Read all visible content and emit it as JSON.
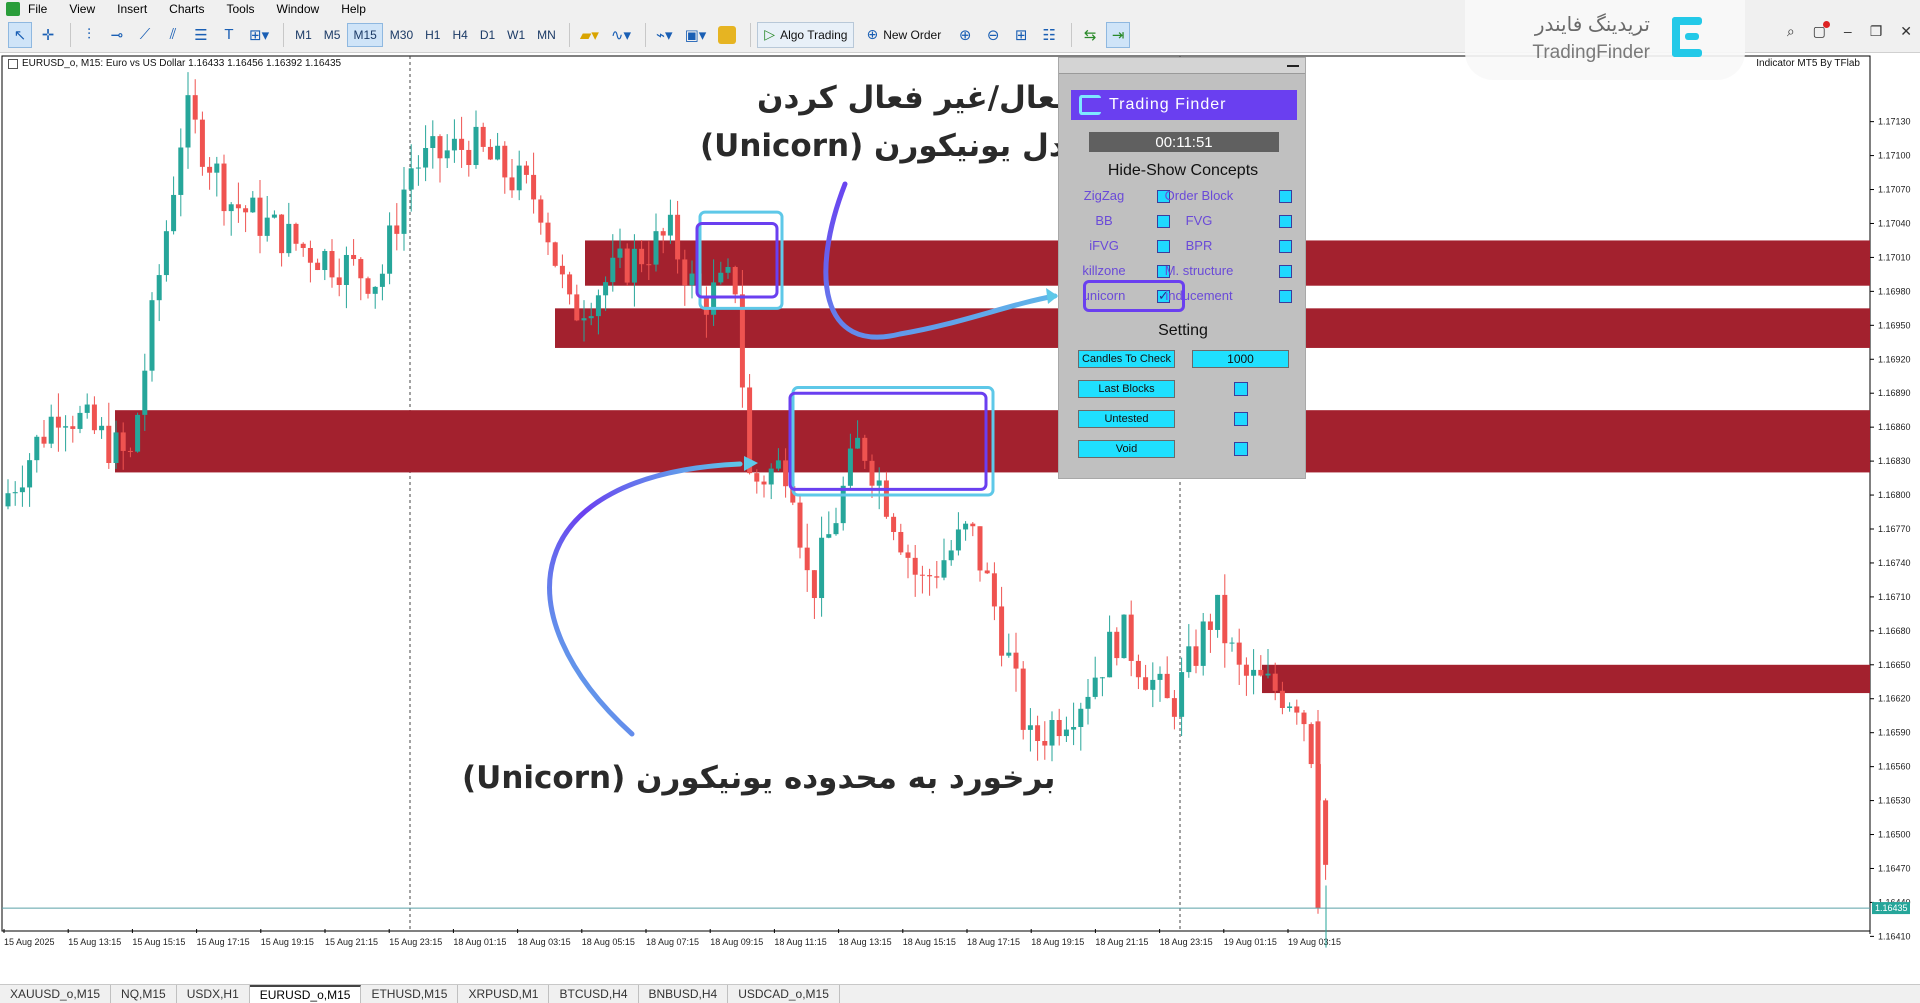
{
  "menu": [
    "File",
    "View",
    "Insert",
    "Charts",
    "Tools",
    "Window",
    "Help"
  ],
  "toolbar": {
    "timeframes": [
      "M1",
      "M5",
      "M15",
      "M30",
      "H1",
      "H4",
      "D1",
      "W1",
      "MN"
    ],
    "active_timeframe": "M15",
    "algo_trading": "Algo Trading",
    "new_order": "New Order"
  },
  "brand": {
    "name_fa": "تریدینگ فایندر",
    "name_en": "TradingFinder"
  },
  "chart": {
    "header": "EURUSD_o, M15:  Euro vs US Dollar  1.16433  1.16456  1.16392  1.16435",
    "indicator": "Indicator MT5 By TFlab",
    "current_price": "1.16435",
    "price_ticks": [
      "1.17130",
      "1.17100",
      "1.17070",
      "1.17040",
      "1.17010",
      "1.16980",
      "1.16950",
      "1.16920",
      "1.16890",
      "1.16860",
      "1.16830",
      "1.16800",
      "1.16770",
      "1.16740",
      "1.16710",
      "1.16680",
      "1.16650",
      "1.16620",
      "1.16590",
      "1.16560",
      "1.16530",
      "1.16500",
      "1.16470",
      "1.16440",
      "1.16410"
    ],
    "time_ticks": [
      "15 Aug 2025",
      "15 Aug 13:15",
      "15 Aug 15:15",
      "15 Aug 17:15",
      "15 Aug 19:15",
      "15 Aug 21:15",
      "15 Aug 23:15",
      "18 Aug 01:15",
      "18 Aug 03:15",
      "18 Aug 05:15",
      "18 Aug 07:15",
      "18 Aug 09:15",
      "18 Aug 11:15",
      "18 Aug 13:15",
      "18 Aug 15:15",
      "18 Aug 17:15",
      "18 Aug 19:15",
      "18 Aug 21:15",
      "18 Aug 23:15",
      "19 Aug 01:15",
      "19 Aug 03:15"
    ],
    "colors": {
      "bull": "#26a69a",
      "bear": "#ef5350",
      "zone": "#a3212e",
      "annotation_box": "#6a3ff0",
      "annotation_box_alt": "#5ec8e8"
    }
  },
  "panel": {
    "brand": "Trading Finder",
    "timer": "00:11:51",
    "concepts_title": "Hide-Show Concepts",
    "concepts": [
      {
        "label": "ZigZag",
        "checked": false
      },
      {
        "label": "Order Block",
        "checked": false
      },
      {
        "label": "BB",
        "checked": false
      },
      {
        "label": "FVG",
        "checked": false
      },
      {
        "label": "iFVG",
        "checked": false
      },
      {
        "label": "BPR",
        "checked": false
      },
      {
        "label": "killzone",
        "checked": false
      },
      {
        "label": "M. structure",
        "checked": false
      },
      {
        "label": "unicorn",
        "checked": true
      },
      {
        "label": "inducement",
        "checked": false
      }
    ],
    "setting_title": "Setting",
    "settings": [
      {
        "label": "Candles To Check",
        "value": "1000"
      },
      {
        "label": "Last Blocks",
        "value": ""
      },
      {
        "label": "Untested",
        "value": ""
      },
      {
        "label": "Void",
        "value": ""
      }
    ]
  },
  "annotations": {
    "toggle_line1": "فعال/غیر فعال کردن",
    "toggle_line2": "مدل یونیکورن (Unicorn)",
    "hit_zone": "برخورد به محدوده یونیکورن (Unicorn)"
  },
  "tabs": [
    "XAUUSD_o,M15",
    "NQ,M15",
    "USDX,H1",
    "EURUSD_o,M15",
    "ETHUSD,M15",
    "XRPUSD,M1",
    "BTCUSD,H4",
    "BNBUSD,H4",
    "USDCAD_o,M15"
  ],
  "active_tab": "EURUSD_o,M15"
}
